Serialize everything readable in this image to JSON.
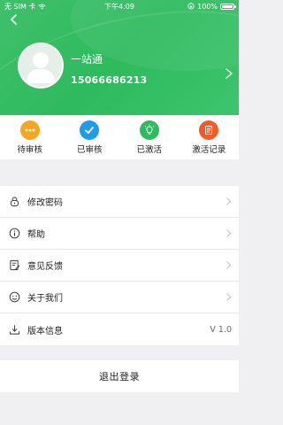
{
  "statusbar": {
    "carrier": "无 SIM 卡",
    "time": "下午4:09",
    "battery": "100%"
  },
  "profile": {
    "name": "一站通",
    "phone": "15066686213"
  },
  "status_items": [
    {
      "label": "待审核",
      "color": "#f5a623",
      "icon": "more-dots-icon"
    },
    {
      "label": "已审核",
      "color": "#1e9be9",
      "icon": "checkmark-icon"
    },
    {
      "label": "已激活",
      "color": "#2fba5e",
      "icon": "lightbulb-icon"
    },
    {
      "label": "激活记录",
      "color": "#f05a28",
      "icon": "document-icon"
    }
  ],
  "menu": [
    {
      "label": "修改密码",
      "icon": "lock-icon"
    },
    {
      "label": "帮助",
      "icon": "info-icon"
    },
    {
      "label": "意见反馈",
      "icon": "feedback-icon"
    },
    {
      "label": "关于我们",
      "icon": "smiley-icon"
    },
    {
      "label": "版本信息",
      "icon": "download-icon",
      "value": "V 1.0"
    }
  ],
  "logout_label": "退出登录",
  "colors": {
    "header_green": "#2fba5e",
    "background": "#f0f0f2"
  }
}
